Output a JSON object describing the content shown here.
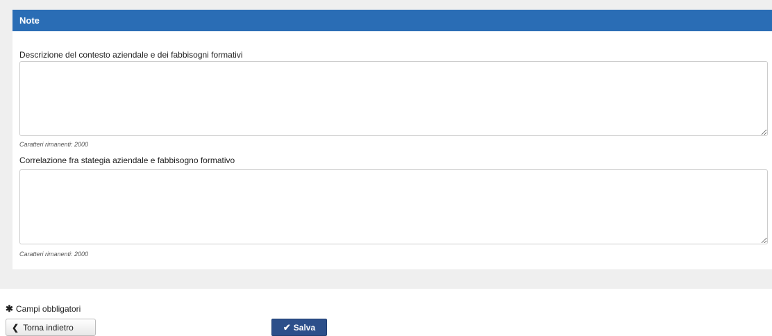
{
  "panel": {
    "title": "Note"
  },
  "fields": [
    {
      "label": "Descrizione del contesto aziendale e dei fabbisogni formativi",
      "value": "",
      "char_counter": "Caratteri rimanenti: 2000"
    },
    {
      "label": "Correlazione fra stategia aziendale e fabbisogno formativo",
      "value": "",
      "char_counter": "Caratteri rimanenti: 2000"
    }
  ],
  "footer": {
    "required_note": "Campi obbligatori",
    "back_label": "Torna indietro",
    "save_label": "Salva"
  },
  "colors": {
    "header_bg": "#2a6db5",
    "save_bg": "#2c4f8a",
    "panel_bg": "#efefef"
  },
  "icons": {
    "required": "asterisk-icon",
    "back": "chevron-left-icon",
    "save": "check-icon"
  }
}
